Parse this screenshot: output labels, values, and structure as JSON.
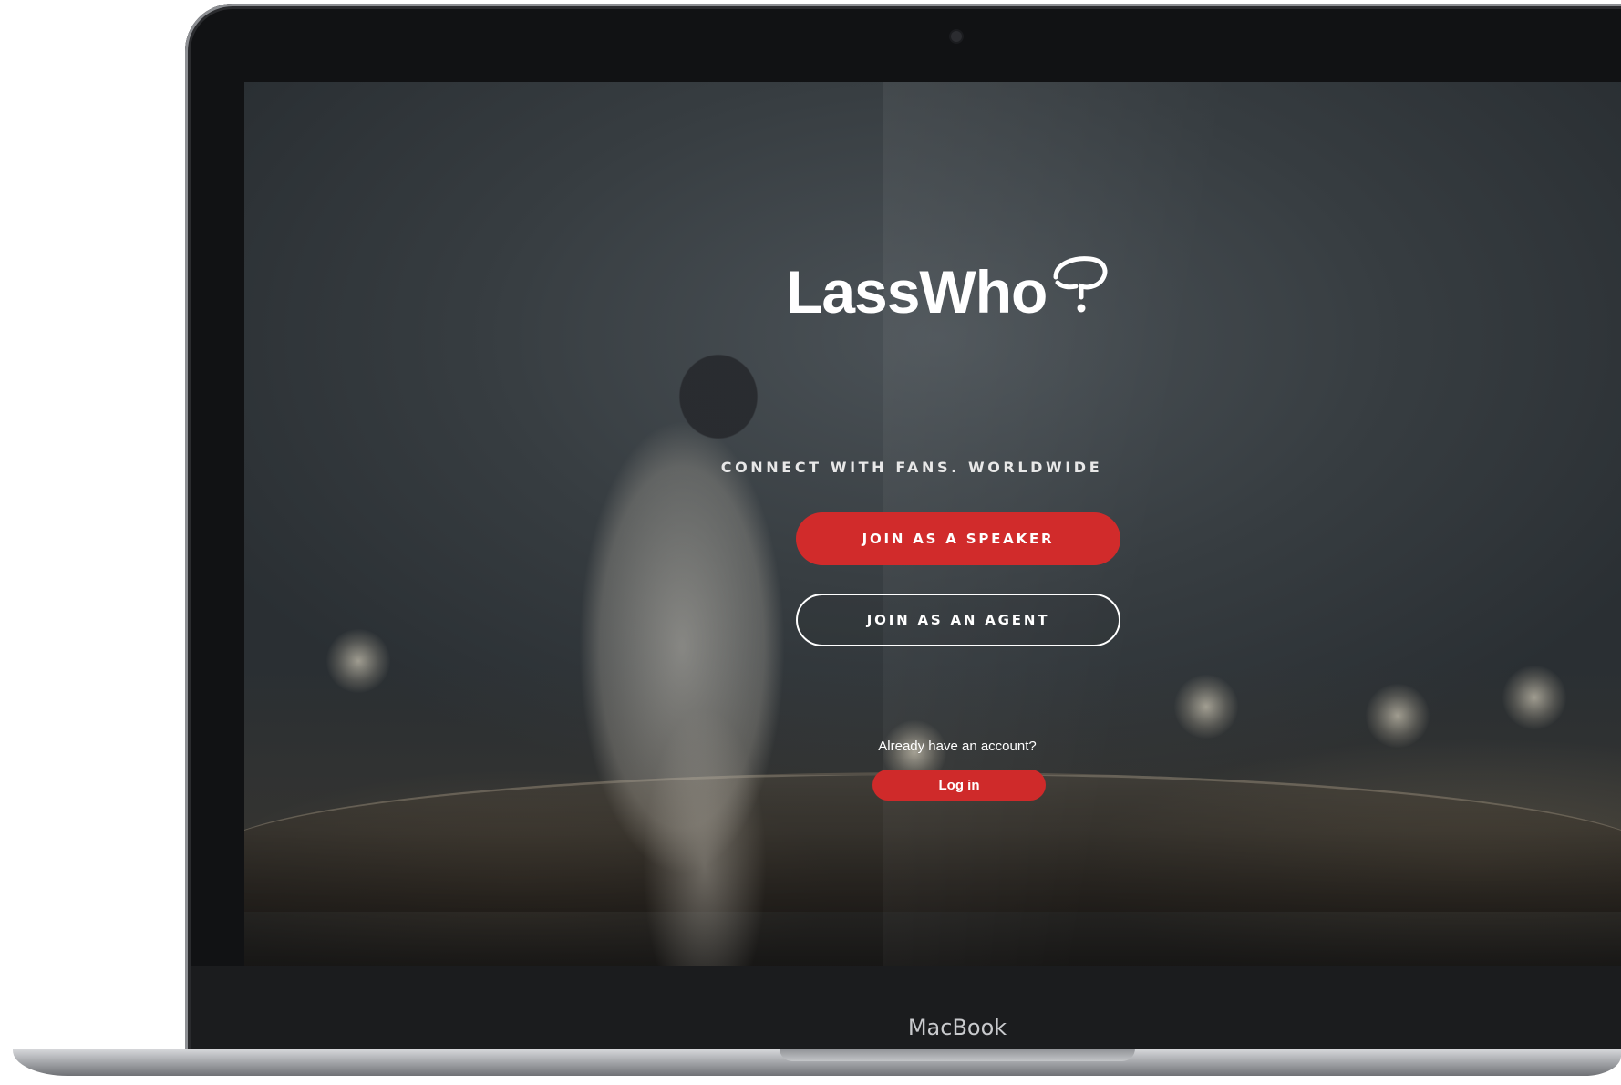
{
  "device": {
    "brand_label": "MacBook"
  },
  "app": {
    "logo_text": "LassWho",
    "logo_mark_icon": "speech-bubble-question-icon",
    "tagline": "CONNECT WITH FANS. WORLDWIDE",
    "primary_button": "JOIN AS A SPEAKER",
    "secondary_button": "JOIN AS AN AGENT",
    "login_prompt": "Already have an account?",
    "login_button": "Log in"
  },
  "colors": {
    "accent": "#d12b2b",
    "text": "#ffffff"
  }
}
